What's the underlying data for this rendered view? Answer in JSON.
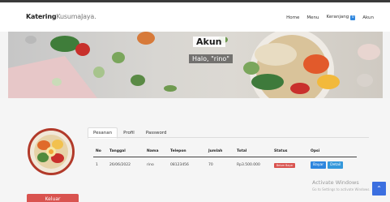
{
  "brand": {
    "bold": "Katering",
    "light": "KusumaJaya."
  },
  "nav": {
    "home": "Home",
    "menu": "Menu",
    "cart": "Keranjang",
    "cart_count": "0",
    "account": "Akun"
  },
  "hero": {
    "title": "Akun",
    "greeting": "Halo, \"rino\""
  },
  "tabs": [
    "Pesanan",
    "Profil",
    "Password"
  ],
  "orders": {
    "headers": [
      "No",
      "Tanggal",
      "Nama",
      "Telepon",
      "Jumlah",
      "Total",
      "Status",
      "Opsi"
    ],
    "rows": [
      {
        "no": "1",
        "tanggal": "26/06/2022",
        "nama": "rino",
        "telepon": "08123456",
        "jumlah": "70",
        "total": "Rp3.500.000",
        "status": "Belum Bayar",
        "pay": "Bayar",
        "detail": "Detail"
      }
    ]
  },
  "logout": "Keluar",
  "watermark": {
    "line1": "Activate Windows",
    "line2": "Go to Settings to activate Windows."
  },
  "colors": {
    "danger": "#d9534f",
    "primary": "#2e86de"
  }
}
